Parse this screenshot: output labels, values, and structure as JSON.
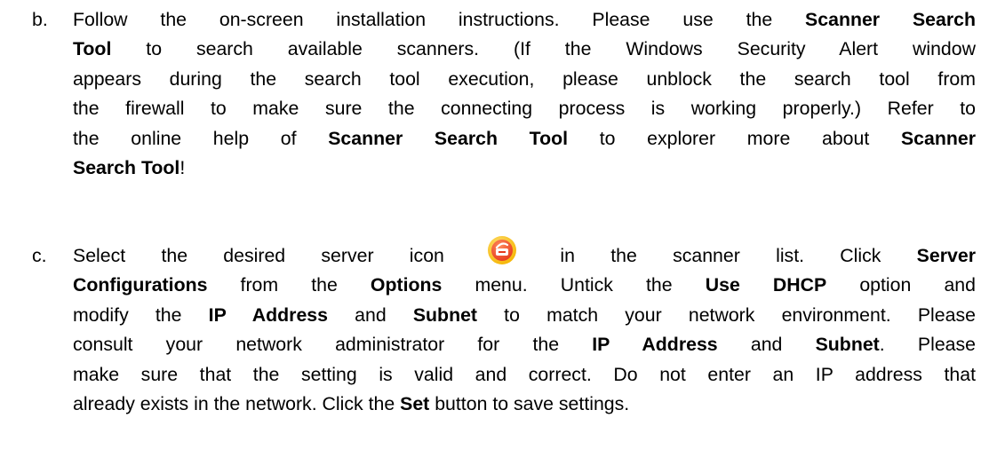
{
  "items": [
    {
      "marker": "b.",
      "lines": [
        [
          {
            "t": "Follow the on-screen installation instructions. Please use the "
          },
          {
            "t": "Scanner Search",
            "b": true
          }
        ],
        [
          {
            "t": "Tool",
            "b": true
          },
          {
            "t": " to search available scanners. (If the Windows Security Alert window"
          }
        ],
        [
          {
            "t": "appears during the search tool execution, please unblock the search tool from"
          }
        ],
        [
          {
            "t": "the firewall to make sure the connecting process is working properly.) Refer to"
          }
        ],
        [
          {
            "t": "the online help of "
          },
          {
            "t": "Scanner Search Tool",
            "b": true
          },
          {
            "t": " to explorer more about "
          },
          {
            "t": "Scanner",
            "b": true
          }
        ],
        [
          {
            "t": "Search Tool",
            "b": true
          },
          {
            "t": "!"
          }
        ]
      ]
    },
    {
      "marker": "c.",
      "lines": [
        [
          {
            "t": "Select the desired server icon "
          },
          {
            "icon": "server-icon"
          },
          {
            "t": " in the scanner list. Click "
          },
          {
            "t": "Server",
            "b": true
          }
        ],
        [
          {
            "t": "Configurations",
            "b": true
          },
          {
            "t": " from the "
          },
          {
            "t": "Options",
            "b": true
          },
          {
            "t": " menu. Untick the "
          },
          {
            "t": "Use DHCP",
            "b": true
          },
          {
            "t": " option and"
          }
        ],
        [
          {
            "t": "modify the "
          },
          {
            "t": "IP Address",
            "b": true
          },
          {
            "t": " and "
          },
          {
            "t": "Subnet",
            "b": true
          },
          {
            "t": " to match your network environment. Please"
          }
        ],
        [
          {
            "t": "consult your network administrator for the "
          },
          {
            "t": "IP Address",
            "b": true
          },
          {
            "t": " and "
          },
          {
            "t": "Subnet",
            "b": true
          },
          {
            "t": ". Please"
          }
        ],
        [
          {
            "t": "make sure that the setting is valid and correct. Do not enter an IP address that"
          }
        ],
        [
          {
            "t": "already exists in the network. Click the "
          },
          {
            "t": "Set",
            "b": true
          },
          {
            "t": " button to save settings."
          }
        ]
      ]
    }
  ],
  "icon_colors": {
    "server_icon_outer": "#f5b400",
    "server_icon_inner": "#e63a1e"
  }
}
